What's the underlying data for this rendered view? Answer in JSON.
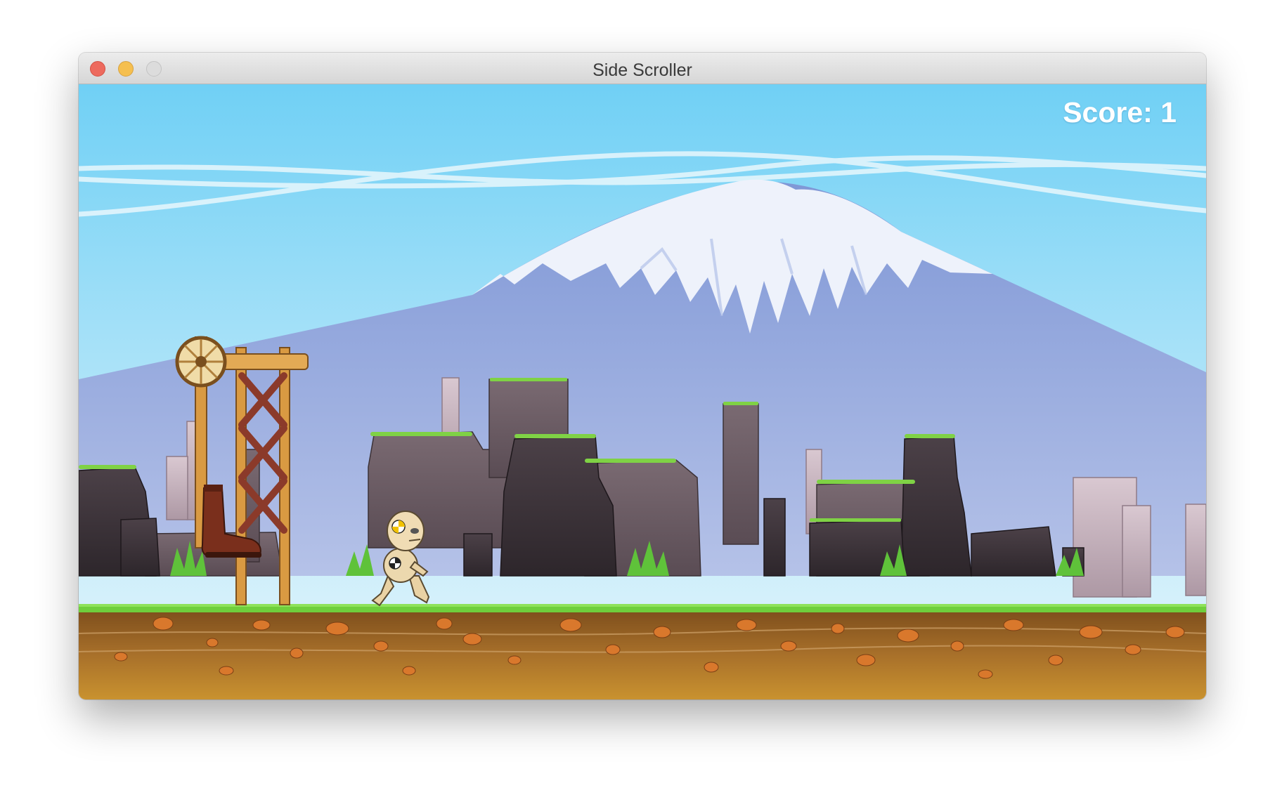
{
  "window": {
    "title": "Side Scroller",
    "controls": [
      "close",
      "minimize",
      "zoom"
    ]
  },
  "hud": {
    "score_text": "Score: 1"
  },
  "scene": {
    "background": "mountain-icon",
    "obstacle": "boot-crusher-icon",
    "player": "crash-test-dummy-icon",
    "ground": "dirt-ground"
  },
  "colors": {
    "sky_top": "#74d2f4",
    "sky_bottom": "#cdeefa",
    "mountain": "#8fa6dc",
    "snow": "#eef2fb",
    "rock_dark": "#3f353b",
    "rock_mid": "#6e5f67",
    "rock_light": "#c6b3bd",
    "grass": "#6fcf3c",
    "dirt_top": "#8a5a22",
    "dirt_bottom": "#c48a2a",
    "pebble": "#d9782c",
    "wood": "#d99a42",
    "brace": "#8b3a2a",
    "boot": "#7a2f1c",
    "score_text": "#ffffff"
  }
}
